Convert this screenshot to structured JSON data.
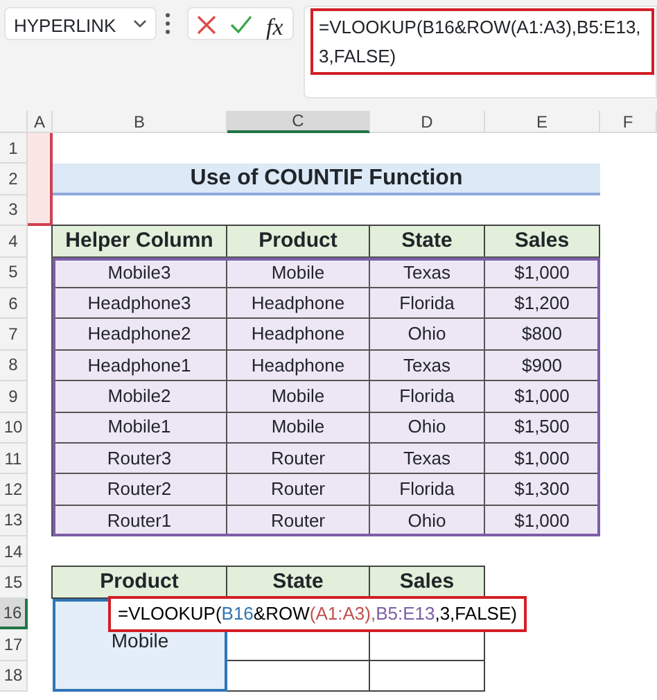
{
  "name_box": "HYPERLINK",
  "formula_bar": {
    "fx": "fx",
    "lines": [
      "=VLOOKUP(B16&ROW(A1:A3),B5:E13,",
      "3,FALSE)"
    ]
  },
  "columns": [
    {
      "label": "A",
      "selected": false
    },
    {
      "label": "B",
      "selected": false
    },
    {
      "label": "C",
      "selected": true
    },
    {
      "label": "D",
      "selected": false
    },
    {
      "label": "E",
      "selected": false
    },
    {
      "label": "F",
      "selected": false
    }
  ],
  "rows": [
    {
      "label": "1",
      "selected": false
    },
    {
      "label": "2",
      "selected": false
    },
    {
      "label": "3",
      "selected": false
    },
    {
      "label": "4",
      "selected": false
    },
    {
      "label": "5",
      "selected": false
    },
    {
      "label": "6",
      "selected": false
    },
    {
      "label": "7",
      "selected": false
    },
    {
      "label": "8",
      "selected": false
    },
    {
      "label": "9",
      "selected": false
    },
    {
      "label": "10",
      "selected": false
    },
    {
      "label": "11",
      "selected": false
    },
    {
      "label": "12",
      "selected": false
    },
    {
      "label": "13",
      "selected": false
    },
    {
      "label": "14",
      "selected": false
    },
    {
      "label": "15",
      "selected": false
    },
    {
      "label": "16",
      "selected": true
    },
    {
      "label": "17",
      "selected": false
    },
    {
      "label": "18",
      "selected": false
    }
  ],
  "title": "Use of COUNTIF Function",
  "table": {
    "columns": [
      "Helper Column",
      "Product",
      "State",
      "Sales"
    ],
    "rows": [
      [
        "Mobile3",
        "Mobile",
        "Texas",
        "$1,000"
      ],
      [
        "Headphone3",
        "Headphone",
        "Florida",
        "$1,200"
      ],
      [
        "Headphone2",
        "Headphone",
        "Ohio",
        "$800"
      ],
      [
        "Headphone1",
        "Headphone",
        "Texas",
        "$900"
      ],
      [
        "Mobile2",
        "Mobile",
        "Florida",
        "$1,000"
      ],
      [
        "Mobile1",
        "Mobile",
        "Ohio",
        "$1,500"
      ],
      [
        "Router3",
        "Router",
        "Texas",
        "$1,000"
      ],
      [
        "Router2",
        "Router",
        "Florida",
        "$1,300"
      ],
      [
        "Router1",
        "Router",
        "Ohio",
        "$1,000"
      ]
    ]
  },
  "lookup": {
    "columns": [
      "Product",
      "State",
      "Sales"
    ],
    "product": "Mobile",
    "formula_parts": [
      {
        "text": "=VLOOKUP(",
        "color": "#000000"
      },
      {
        "text": "B16",
        "color": "#2f75b5"
      },
      {
        "text": "&ROW",
        "color": "#000000"
      },
      {
        "text": "(A1:A3),",
        "color": "#c0504d"
      },
      {
        "text": "B5:E13",
        "color": "#7b5ea7"
      },
      {
        "text": ",3,FALSE)",
        "color": "#000000"
      }
    ]
  }
}
